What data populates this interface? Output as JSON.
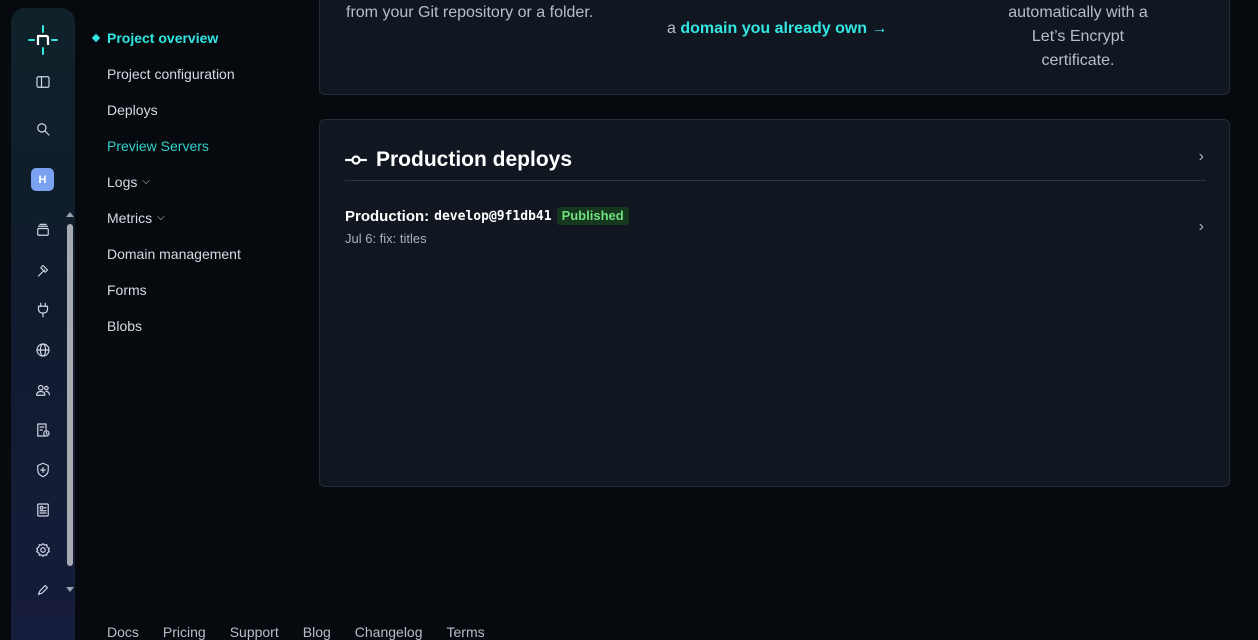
{
  "rail": {
    "avatar_initial": "H",
    "icons": [
      "netlify-logo",
      "sidebar-toggle-icon",
      "search-icon",
      "team-avatar",
      "projects-icon",
      "builds-icon",
      "integrations-icon",
      "domains-icon",
      "members-icon",
      "audit-log-icon",
      "security-icon",
      "billing-icon",
      "settings-icon",
      "edit-icon"
    ]
  },
  "subnav": {
    "items": [
      {
        "label": "Project overview"
      },
      {
        "label": "Project configuration"
      },
      {
        "label": "Deploys"
      },
      {
        "label": "Preview Servers"
      },
      {
        "label": "Logs"
      },
      {
        "label": "Metrics"
      },
      {
        "label": "Domain management"
      },
      {
        "label": "Forms"
      },
      {
        "label": "Blobs"
      }
    ]
  },
  "top_card": {
    "col1": "from your Git repository or a folder.",
    "col2_prefix": "a",
    "col2_link": "domain you already own →",
    "col3_line1": "automatically with a",
    "col3_line2": "Let’s Encrypt certificate."
  },
  "deploys": {
    "title": "Production deploys",
    "row": {
      "prefix": "Production:",
      "ref": "develop@9f1db41",
      "badge": "Published",
      "subtitle": "Jul 6: fix: titles"
    }
  },
  "footer": {
    "links": [
      "Docs",
      "Pricing",
      "Support",
      "Blog",
      "Changelog",
      "Terms"
    ]
  },
  "colors": {
    "accent": "#32e6e2",
    "published_badge_bg": "#16361f",
    "published_badge_text": "#6ee07c"
  }
}
